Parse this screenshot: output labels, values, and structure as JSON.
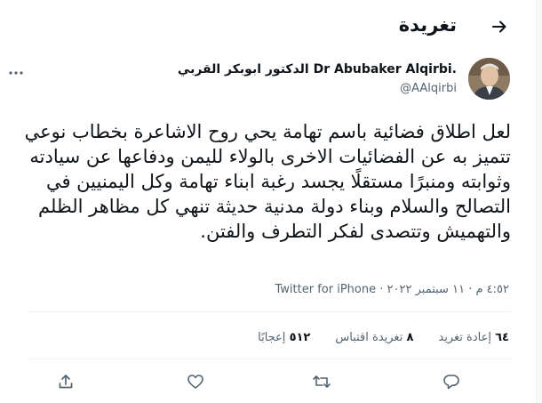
{
  "header": {
    "title": "تغريدة",
    "back_icon": "arrow-right-icon"
  },
  "author": {
    "display_name": "الدكتور ابوبكر القربي Dr Abubaker Alqirbi.",
    "handle": "@AAlqirbi",
    "avatar_icon": "avatar-photo",
    "more_icon": "ellipsis-icon"
  },
  "tweet": {
    "text": "لعل اطلاق فضائية باسم تهامة يحي روح الاشاعرة بخطاب نوعي تتميز به عن الفضائيات الاخرى بالولاء لليمن ودفاعها عن سيادته وثوابته ومنبرًا مستقلًا يجسد رغبة ابناء تهامة وكل اليمنيين في التصالح والسلام وبناء دولة مدنية حديثة تنهي كل مظاهر الظلم والتهميش وتتصدى لفكر التطرف والفتن.",
    "time": "٤:٥٢ م",
    "separator": "·",
    "date": "١١ سبتمبر ٢٠٢٢",
    "source": "Twitter for iPhone"
  },
  "stats": {
    "retweets_count": "٦٤",
    "retweets_label": "إعادة تغريد",
    "quotes_count": "٨",
    "quotes_label": "تغريدة اقتباس",
    "likes_count": "٥١٢",
    "likes_label": "إعجابًا"
  },
  "actions": {
    "reply_icon": "reply-icon",
    "retweet_icon": "retweet-icon",
    "like_icon": "heart-icon",
    "share_icon": "share-icon"
  },
  "colors": {
    "text": "#0f1419",
    "secondary": "#536471",
    "divider": "#eff3f4"
  }
}
